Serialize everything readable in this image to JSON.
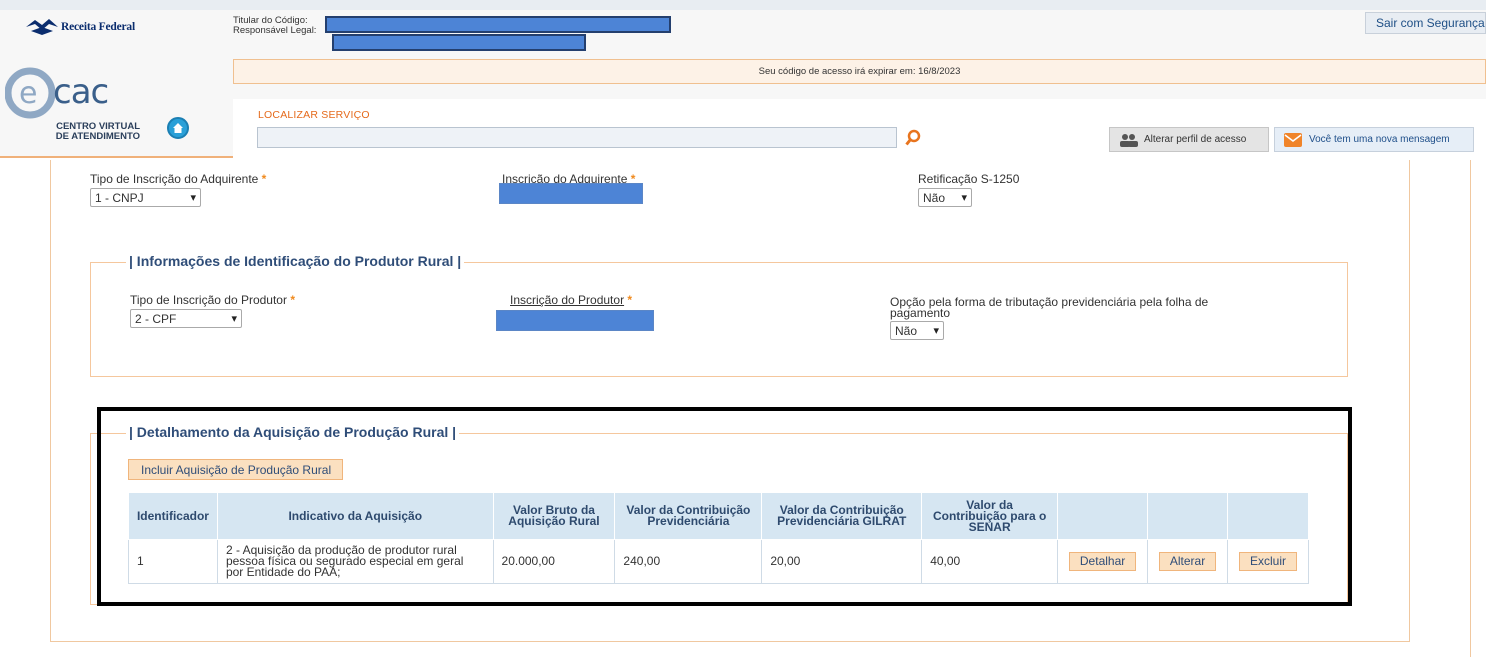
{
  "header": {
    "logo_text": "Receita Federal",
    "ecac_subtitle_line1": "CENTRO VIRTUAL",
    "ecac_subtitle_line2": "DE ATENDIMENTO",
    "titular_label": "Titular do Código:",
    "responsavel_label": "Responsável Legal:",
    "logout_label": "Sair com Segurança",
    "expiry_text": "Seu código de acesso irá expirar em: 16/8/2023",
    "search_label": "LOCALIZAR SERVIÇO",
    "search_value": "",
    "profile_button": "Alterar perfil de acesso",
    "message_button": "Você tem uma nova mensagem"
  },
  "form": {
    "tipo_adquirente_label": "Tipo de Inscrição do Adquirente",
    "tipo_adquirente_value": "1 - CNPJ",
    "inscricao_adquirente_label": "Inscrição do Adquirente",
    "retificacao_label": "Retificação S-1250",
    "retificacao_value": "Não",
    "required_mark": "*"
  },
  "produtor": {
    "legend": "| Informações de Identificação do Produtor Rural |",
    "tipo_label": "Tipo de Inscrição do Produtor",
    "tipo_value": "2 - CPF",
    "inscricao_label": "Inscrição do Produtor",
    "opcao_label_line1": "Opção pela forma de tributação previdenciária pela folha de",
    "opcao_label_line2": "pagamento",
    "opcao_value": "Não"
  },
  "aquisicao": {
    "legend": "| Detalhamento da Aquisição de Produção Rural |",
    "add_button": "Incluir Aquisição de Produção Rural",
    "columns": [
      "Identificador",
      "Indicativo da Aquisição",
      "Valor Bruto da Aquisição Rural",
      "Valor da Contribuição Previdenciária",
      "Valor da Contribuição Previdenciária GILRAT",
      "Valor da Contribuição para o SENAR"
    ],
    "rows": [
      {
        "identificador": "1",
        "indicativo": "2 - Aquisição da produção de produtor rural pessoa física ou segurado especial em geral por Entidade do PAA;",
        "valor_bruto": "20.000,00",
        "contrib_prev": "240,00",
        "contrib_gilrat": "20,00",
        "contrib_senar": "40,00",
        "detalhar": "Detalhar",
        "alterar": "Alterar",
        "excluir": "Excluir"
      }
    ]
  }
}
